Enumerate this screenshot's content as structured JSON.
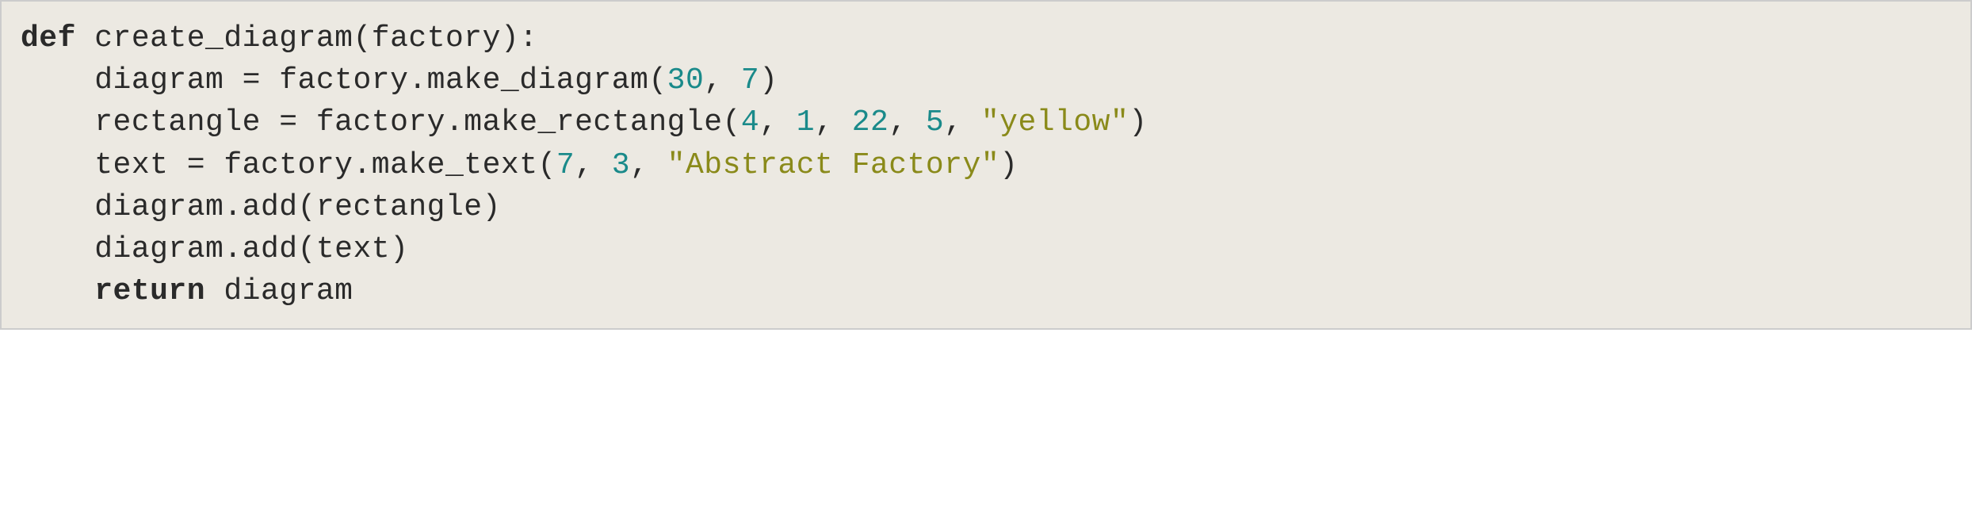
{
  "code": {
    "line1": {
      "keyword": "def",
      "rest": " create_diagram(factory):"
    },
    "line2": {
      "indent": "    ",
      "part1": "diagram = factory.make_diagram(",
      "num1": "30",
      "comma1": ", ",
      "num2": "7",
      "part2": ")"
    },
    "line3": {
      "indent": "    ",
      "part1": "rectangle = factory.make_rectangle(",
      "num1": "4",
      "comma1": ", ",
      "num2": "1",
      "comma2": ", ",
      "num3": "22",
      "comma3": ", ",
      "num4": "5",
      "comma4": ", ",
      "str1": "\"yellow\"",
      "part2": ")"
    },
    "line4": {
      "indent": "    ",
      "part1": "text = factory.make_text(",
      "num1": "7",
      "comma1": ", ",
      "num2": "3",
      "comma2": ", ",
      "str1": "\"Abstract Factory\"",
      "part2": ")"
    },
    "line5": {
      "indent": "    ",
      "text": "diagram.add(rectangle)"
    },
    "line6": {
      "indent": "    ",
      "text": "diagram.add(text)"
    },
    "line7": {
      "indent": "    ",
      "keyword": "return",
      "rest": " diagram"
    }
  }
}
